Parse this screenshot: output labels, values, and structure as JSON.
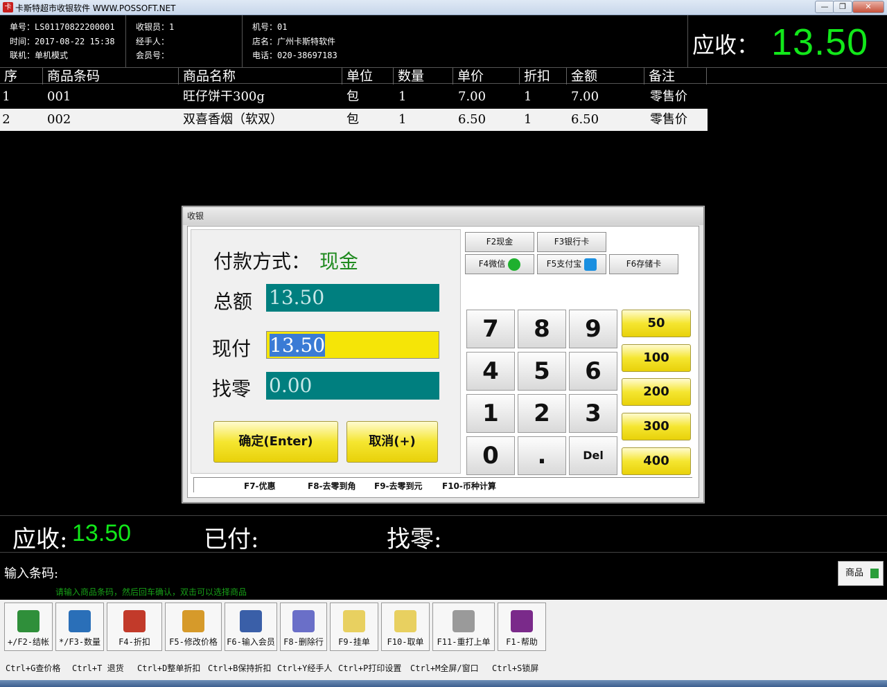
{
  "window": {
    "title": "卡斯特超市收银软件 WWW.POSSOFT.NET"
  },
  "header": {
    "order_no": "单号：LS01170822200001",
    "time": "时间：2017-08-22 15:38",
    "mode": "联机：单机模式",
    "cashier": "收银员：1",
    "handler": "经手人：",
    "member": "会员号：",
    "machine": "机号：01",
    "store": "店名：广州卡斯特软件",
    "phone": "电话：020-38697183",
    "receivable_label": "应收：",
    "receivable_value": "13.50"
  },
  "table": {
    "columns": [
      "序",
      "商品条码",
      "商品名称",
      "单位",
      "数量",
      "单价",
      "折扣",
      "金额",
      "备注"
    ],
    "rows": [
      [
        "1",
        "001",
        "旺仔饼干300g",
        "包",
        "1",
        "7.00",
        "1",
        "7.00",
        "零售价"
      ],
      [
        "2",
        "002",
        "双喜香烟（软双）",
        "包",
        "1",
        "6.50",
        "1",
        "6.50",
        "零售价"
      ]
    ]
  },
  "dialog": {
    "title": "收银",
    "payment_method_label": "付款方式：",
    "payment_method_value": "现金",
    "total_label": "总额",
    "total_value": "13.50",
    "paid_label": "现付",
    "paid_value": "13.50",
    "change_label": "找零",
    "change_value": "0.00",
    "confirm_label": "确定(Enter)",
    "cancel_label": "取消(+)",
    "pay_buttons": [
      "F2现金",
      "F3银行卡",
      "F4微信",
      "F5支付宝",
      "F6存储卡"
    ],
    "keys": [
      "7",
      "8",
      "9",
      "4",
      "5",
      "6",
      "1",
      "2",
      "3",
      "0",
      ".",
      "Del"
    ],
    "amounts": [
      "50",
      "100",
      "200",
      "300",
      "400"
    ],
    "hotkeys": [
      "F7-优惠",
      "F8-去零到角",
      "F9-去零到元",
      "F10-币种计算"
    ]
  },
  "summary": {
    "receivable_label": "应收:",
    "receivable_value": "13.50",
    "paid_label": "已付:",
    "change_label": "找零:"
  },
  "input": {
    "label": "输入条码:",
    "hint": "请输入商品条码，然后回车确认，双击可以选择商品",
    "goods_button": "商品"
  },
  "toolbar": [
    "+/F2-结帐",
    "*/F3-数量",
    "F4-折扣",
    "F5-修改价格",
    "F6-输入会员",
    "F8-删除行",
    "F9-挂单",
    "F10-取单",
    "F11-重打上单",
    "F1-帮助"
  ],
  "shortcuts": [
    "Ctrl+G查价格",
    "Ctrl+T 退货",
    "Ctrl+D整单折扣",
    "Ctrl+B保持折扣",
    "Ctrl+Y经手人",
    "Ctrl+P打印设置",
    "Ctrl+M全屏/窗口",
    "Ctrl+S锁屏"
  ],
  "colors": {
    "accent_green": "#12e81a",
    "teal": "#007f7f",
    "yellow": "#f5e507"
  }
}
